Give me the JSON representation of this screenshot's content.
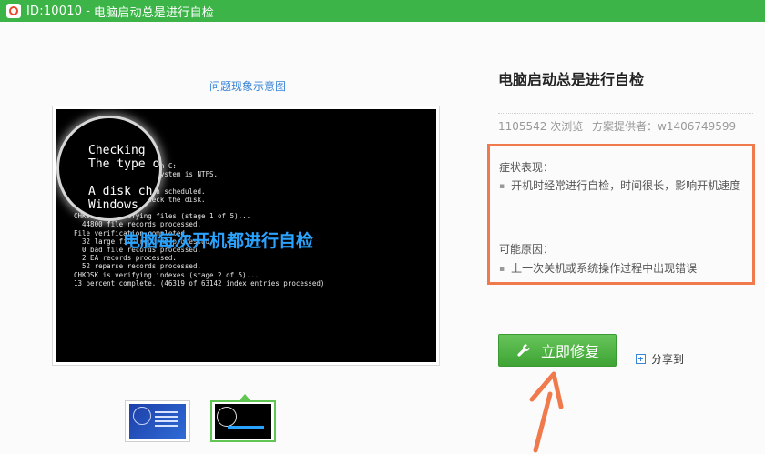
{
  "window": {
    "id_label": "ID:10010",
    "separator": "-",
    "title": "电脑启动总是进行自检",
    "accent_color": "#3cb448"
  },
  "preview": {
    "caption": "问题现象示意图",
    "console_lines": [
      "                 em on C:",
      "                 le system is NTFS.",
      "",
      "                 been scheduled.",
      "                 check the disk.",
      "",
      "CHKDSK is verifying files (stage 1 of 5)...",
      "  44800 file records processed.",
      "File verification completed.",
      "  32 large file records processed.",
      "  0 bad file records processed.",
      "  2 EA records processed.",
      "  52 reparse records processed.",
      "CHKDSK is verifying indexes (stage 2 of 5)...",
      "13 percent complete. (46319 of 63142 index entries processed)"
    ],
    "magnified_lines": [
      "Checking",
      "The type o",
      "",
      "A disk ch",
      "Windows"
    ],
    "overlay_text": "电脑每次开机都进行自检",
    "thumbnails": [
      "thumbnail-1",
      "thumbnail-2"
    ],
    "selected_thumbnail": 2
  },
  "details": {
    "title": "电脑启动总是进行自检",
    "views": "1105542 次浏览",
    "provider": "方案提供者：w1406749599",
    "symptom_label": "症状表现：",
    "symptoms": [
      "开机时经常进行自检，时间很长，影响开机速度"
    ],
    "cause_label": "可能原因：",
    "causes": [
      "上一次关机或系统操作过程中出现错误"
    ],
    "highlight_color": "#f07a4b"
  },
  "actions": {
    "fix_label": "立即修复",
    "fix_icon": "wrench-icon",
    "share_label": "分享到",
    "share_icon": "plus-icon"
  }
}
